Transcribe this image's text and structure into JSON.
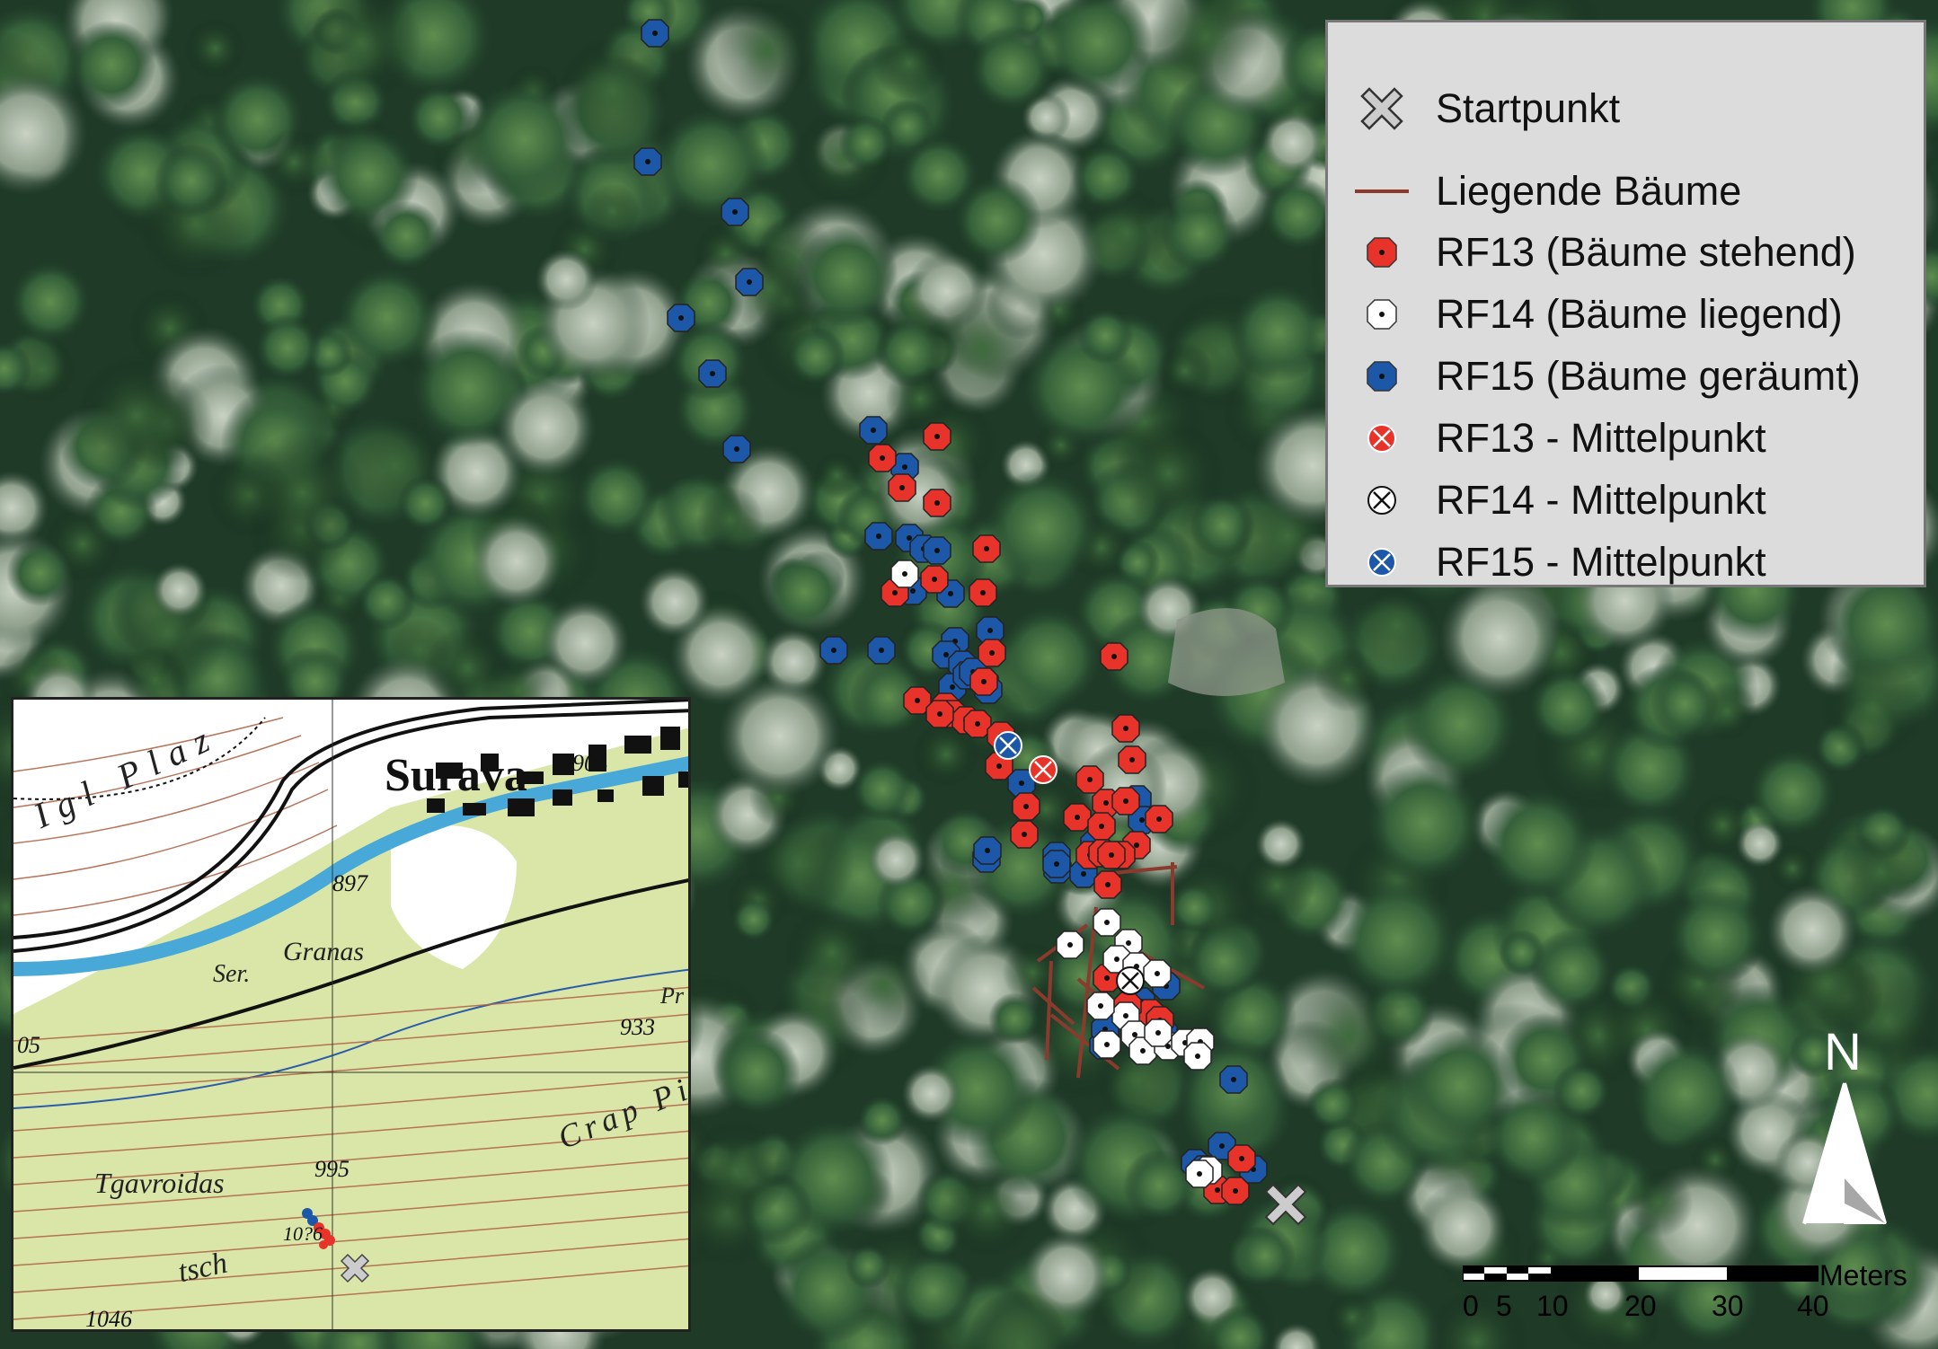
{
  "legend": {
    "items": [
      {
        "label": "Startpunkt",
        "symbol": "start-cross"
      },
      {
        "label": "Liegende Bäume",
        "symbol": "line"
      },
      {
        "label": "RF13 (Bäume stehend)",
        "symbol": "red-octagon"
      },
      {
        "label": "RF14 (Bäume liegend)",
        "symbol": "white-octagon"
      },
      {
        "label": "RF15 (Bäume geräumt)",
        "symbol": "blue-octagon"
      },
      {
        "label": "RF13 - Mittelpunkt",
        "symbol": "red-circle-x"
      },
      {
        "label": "RF14 - Mittelpunkt",
        "symbol": "white-circle-x"
      },
      {
        "label": "RF15 - Mittelpunkt",
        "symbol": "blue-circle-x"
      }
    ]
  },
  "colors": {
    "rf13": "#e8332b",
    "rf14": "#ffffff",
    "rf15": "#1c57a8",
    "fallen_tree_line": "#8b3a2e",
    "start": "#cccccc"
  },
  "north_arrow": {
    "label": "N"
  },
  "scale_bar": {
    "unit": "Meters",
    "ticks": [
      "0",
      "5",
      "10",
      "20",
      "30",
      "40"
    ]
  },
  "inset_map": {
    "town": "Surava",
    "place_names": [
      "Igl Plaz",
      "Granas",
      "Ser.",
      "Tgavroidas",
      "Crap Pis",
      "tsch",
      "Pr"
    ],
    "elevations": [
      "904",
      "897",
      "933",
      "995",
      "1046",
      "05",
      "10?6"
    ]
  }
}
